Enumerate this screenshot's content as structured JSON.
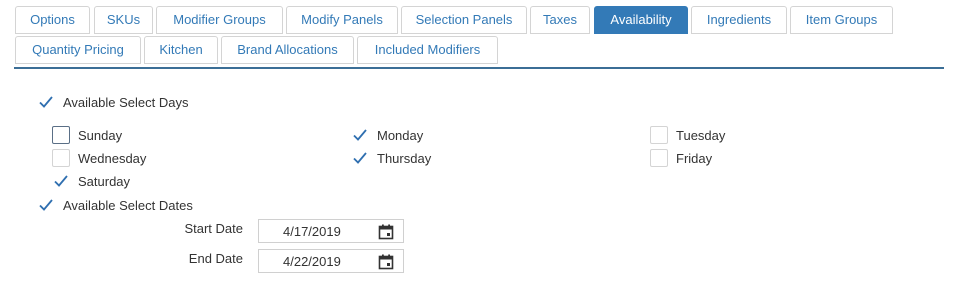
{
  "tabs": [
    {
      "label": "Options",
      "active": false
    },
    {
      "label": "SKUs",
      "active": false
    },
    {
      "label": "Modifier Groups",
      "active": false
    },
    {
      "label": "Modify Panels",
      "active": false
    },
    {
      "label": "Selection Panels",
      "active": false
    },
    {
      "label": "Taxes",
      "active": false
    },
    {
      "label": "Availability",
      "active": true
    },
    {
      "label": "Ingredients",
      "active": false
    },
    {
      "label": "Item Groups",
      "active": false
    },
    {
      "label": "Quantity Pricing",
      "active": false
    },
    {
      "label": "Kitchen",
      "active": false
    },
    {
      "label": "Brand Allocations",
      "active": false
    },
    {
      "label": "Included Modifiers",
      "active": false
    }
  ],
  "availability": {
    "select_days": {
      "label": "Available Select Days",
      "checked": true
    },
    "days": [
      {
        "label": "Sunday",
        "checked": false
      },
      {
        "label": "Monday",
        "checked": true
      },
      {
        "label": "Tuesday",
        "checked": false
      },
      {
        "label": "Wednesday",
        "checked": false
      },
      {
        "label": "Thursday",
        "checked": true
      },
      {
        "label": "Friday",
        "checked": false
      },
      {
        "label": "Saturday",
        "checked": true
      }
    ],
    "select_dates": {
      "label": "Available Select Dates",
      "checked": true
    },
    "start_date": {
      "label": "Start Date",
      "value": "4/17/2019"
    },
    "end_date": {
      "label": "End Date",
      "value": "4/22/2019"
    }
  },
  "colors": {
    "accent": "#337ab7",
    "check": "#2f6fb0",
    "divider": "#3b6e96"
  },
  "icons": {
    "check": "check-icon",
    "calendar": "calendar-icon"
  }
}
